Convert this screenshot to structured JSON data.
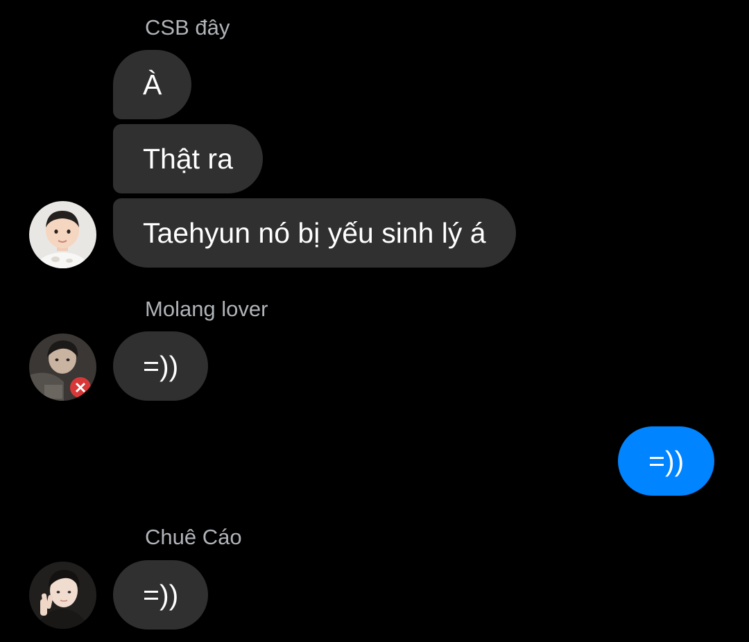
{
  "groups": [
    {
      "sender": "CSB đây",
      "avatar_icon": "toddler-portrait-avatar",
      "messages": [
        "À",
        "Thật ra",
        "Taehyun nó bị yếu sinh lý á"
      ]
    },
    {
      "sender": "Molang lover",
      "avatar_icon": "dark-selfie-avatar",
      "messages": [
        "=))"
      ]
    },
    {
      "sender": "",
      "messages": [
        "=))"
      ],
      "outgoing": true
    },
    {
      "sender": "Chuê Cáo",
      "avatar_icon": "peace-sign-selfie-avatar",
      "messages": [
        "=))"
      ]
    }
  ],
  "colors": {
    "background": "#000000",
    "incoming_bubble": "#303030",
    "outgoing_bubble": "#0084ff",
    "sender_name": "#b0b3b8",
    "message_text": "#ffffff"
  }
}
